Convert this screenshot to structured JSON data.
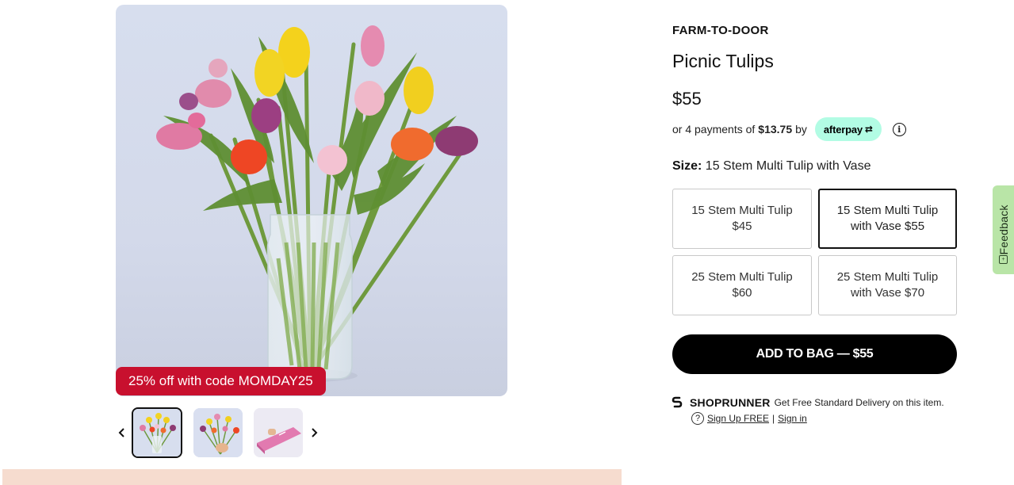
{
  "gallery": {
    "promo_text": "25% off with code MOMDAY25",
    "thumbnails": [
      {
        "name": "bouquet-in-vase",
        "selected": true
      },
      {
        "name": "bouquet-in-hand",
        "selected": false
      },
      {
        "name": "gift-box",
        "selected": false
      }
    ]
  },
  "product": {
    "brand": "FARM-TO-DOOR",
    "title": "Picnic Tulips",
    "price": "$55",
    "afterpay": {
      "prefix": "or 4 payments of",
      "amount": "$13.75",
      "suffix": "by",
      "logo_text": "afterpay",
      "logo_color": "#b2fce4"
    },
    "size": {
      "label": "Size:",
      "selected_value": "15 Stem Multi Tulip with Vase"
    },
    "size_options": [
      {
        "label": "15 Stem Multi Tulip $45",
        "selected": false
      },
      {
        "label": "15 Stem Multi Tulip with Vase $55",
        "selected": true
      },
      {
        "label": "25 Stem Multi Tulip $60",
        "selected": false
      },
      {
        "label": "25 Stem Multi Tulip with Vase $70",
        "selected": false
      }
    ],
    "add_to_bag_label": "ADD TO BAG — $55"
  },
  "shoprunner": {
    "brand": "SHOPRUNNER",
    "tagline": "Get Free Standard Delivery on this item.",
    "signup_label": "Sign Up FREE",
    "separator": "|",
    "signin_label": "Sign in"
  },
  "feedback": {
    "label": "Feedback"
  },
  "colors": {
    "promo_red": "#c8102e",
    "button_black": "#000000",
    "feedback_green": "#b9e5a7",
    "banner_peach": "#f6dccf"
  }
}
